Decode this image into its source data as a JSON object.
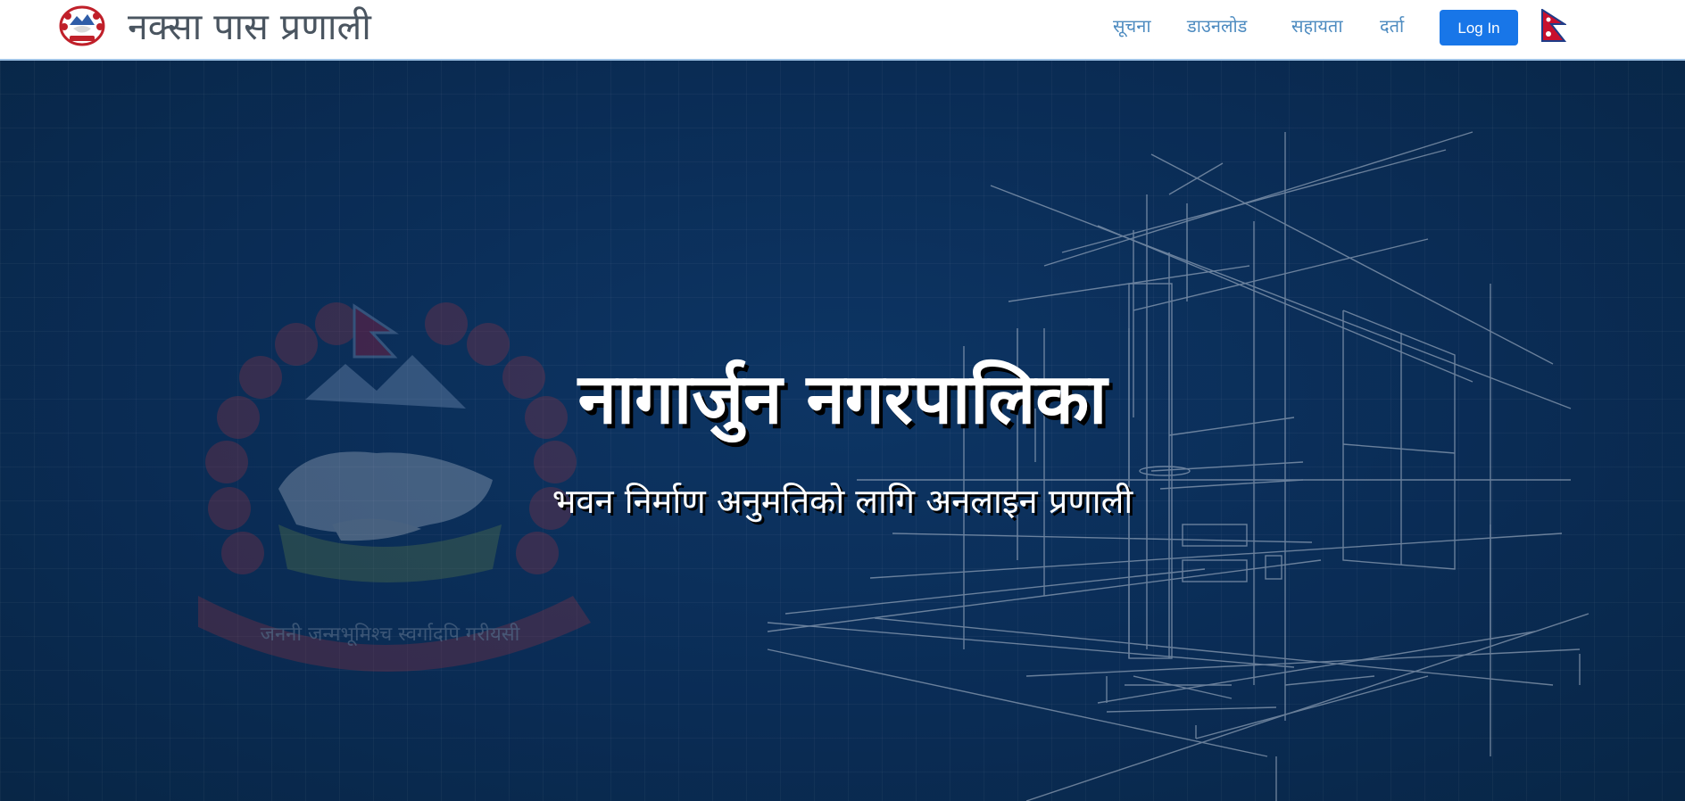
{
  "header": {
    "brand_title": "नक्सा पास प्रणाली",
    "logo_icon": "nepal-emblem-icon",
    "nav": [
      {
        "label": "सूचना"
      },
      {
        "label": "डाउनलोड"
      },
      {
        "label": "सहायता"
      },
      {
        "label": "दर्ता"
      }
    ],
    "login_label": "Log In",
    "flag_icon": "nepal-flag-icon"
  },
  "hero": {
    "title": "नागार्जुन नगरपालिका",
    "subtitle": "भवन निर्माण अनुमतिको लागि अनलाइन प्रणाली",
    "emblem_motto": "जननी जन्मभूमिश्च स्वर्गादपि गरीयसी",
    "background_icon": "building-sketch-icon"
  },
  "colors": {
    "accent": "#1876e8",
    "nav_link": "#4d8bc0",
    "hero_bg": "#0b2c52",
    "brand_text": "#4a5560"
  }
}
